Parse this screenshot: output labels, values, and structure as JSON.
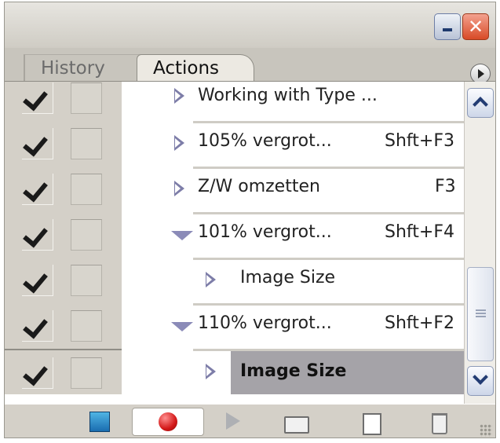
{
  "tabs": [
    {
      "label": "History",
      "active": false
    },
    {
      "label": "Actions",
      "active": true
    }
  ],
  "actions": [
    {
      "label": "Working with Type ...",
      "shortcut": "",
      "expanded": false,
      "indent": 1,
      "checked": true,
      "selected": false
    },
    {
      "label": "105% vergrot...",
      "shortcut": "Shft+F3",
      "expanded": false,
      "indent": 1,
      "checked": true,
      "selected": false
    },
    {
      "label": "Z/W omzetten",
      "shortcut": "F3",
      "expanded": false,
      "indent": 1,
      "checked": true,
      "selected": false
    },
    {
      "label": "101% vergrot...",
      "shortcut": "Shft+F4",
      "expanded": true,
      "indent": 1,
      "checked": true,
      "selected": false
    },
    {
      "label": "Image Size",
      "shortcut": "",
      "expanded": false,
      "indent": 2,
      "checked": true,
      "selected": false
    },
    {
      "label": "110% vergrot...",
      "shortcut": "Shft+F2",
      "expanded": true,
      "indent": 1,
      "checked": true,
      "selected": false
    },
    {
      "label": "Image Size",
      "shortcut": "",
      "expanded": false,
      "indent": 2,
      "checked": true,
      "selected": true
    }
  ],
  "icons": {
    "minimize": "minimize-icon",
    "close": "close-icon",
    "panel_menu": "panel-menu-icon",
    "stop": "stop-icon",
    "record": "record-icon",
    "play": "play-icon",
    "new_set": "folder-icon",
    "new_action": "new-action-icon",
    "delete": "trash-icon"
  },
  "colors": {
    "panel_bg": "#d4d0c8",
    "selected_row": "#a5a3a8",
    "record": "#d31818",
    "stop": "#1a6db0",
    "close_button": "#d84a26"
  }
}
